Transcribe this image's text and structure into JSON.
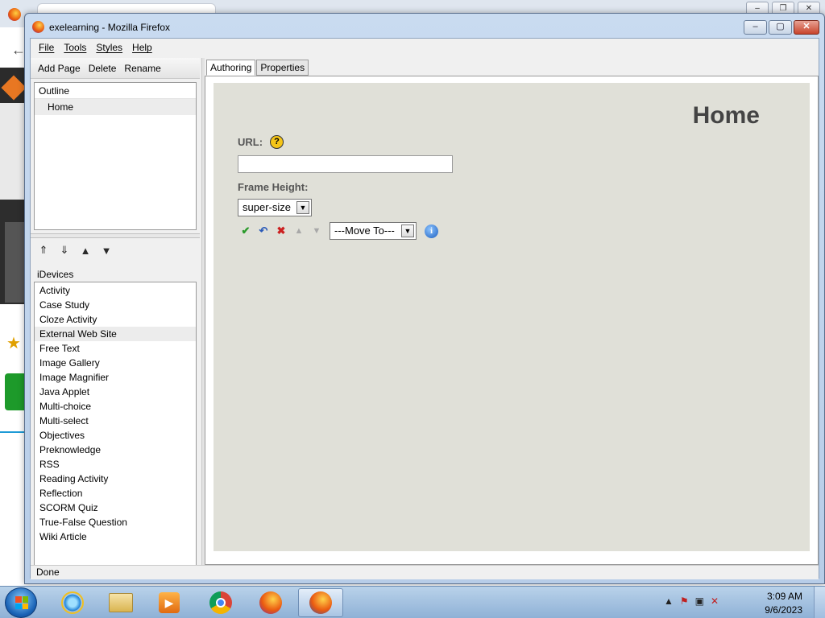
{
  "window": {
    "title": "exelearning - Mozilla Firefox",
    "controls": {
      "minimize": "–",
      "maximize": "▢",
      "close": "✕"
    }
  },
  "menu": {
    "file": "File",
    "tools": "Tools",
    "styles": "Styles",
    "help": "Help"
  },
  "outline_toolbar": {
    "add_page": "Add Page",
    "delete": "Delete",
    "rename": "Rename"
  },
  "outline": {
    "header": "Outline",
    "pages": [
      "Home"
    ]
  },
  "outline_actions": {
    "promote": "⇑",
    "demote": "⇓",
    "move_up": "▲",
    "move_down": "▼"
  },
  "idevices": {
    "label": "iDevices",
    "items": [
      "Activity",
      "Case Study",
      "Cloze Activity",
      "External Web Site",
      "Free Text",
      "Image Gallery",
      "Image Magnifier",
      "Java Applet",
      "Multi-choice",
      "Multi-select",
      "Objectives",
      "Preknowledge",
      "RSS",
      "Reading Activity",
      "Reflection",
      "SCORM Quiz",
      "True-False Question",
      "Wiki Article"
    ],
    "selected": "External Web Site"
  },
  "tabs": {
    "authoring": "Authoring",
    "properties": "Properties",
    "active": "Authoring"
  },
  "editor": {
    "page_heading": "Home",
    "url_label": "URL:",
    "url_value": "",
    "help_glyph": "?",
    "frame_height_label": "Frame Height:",
    "frame_height_value": "super-size",
    "move_to": "---Move To---",
    "info_glyph": "i",
    "actions": {
      "done": "✔",
      "undo": "↶",
      "delete": "✖",
      "up": "▲",
      "down": "▼"
    }
  },
  "status": {
    "text": "Done"
  },
  "taskbar": {
    "apps": [
      "internet-explorer",
      "file-explorer",
      "media-player",
      "chrome",
      "firefox",
      "firefox-exelearning"
    ],
    "active_app": "firefox-exelearning",
    "clock_time": "3:09 AM",
    "clock_date": "9/6/2023",
    "tray_icons": [
      "show-hidden-icons",
      "action-center-icon",
      "network-icon",
      "volume-muted-icon"
    ]
  },
  "colors": {
    "content_bg": "#e0e0d8",
    "check_green": "#2a9a2a",
    "delete_red": "#cc2020",
    "info_blue": "#1d5fbf",
    "help_yellow": "#f5c518"
  }
}
